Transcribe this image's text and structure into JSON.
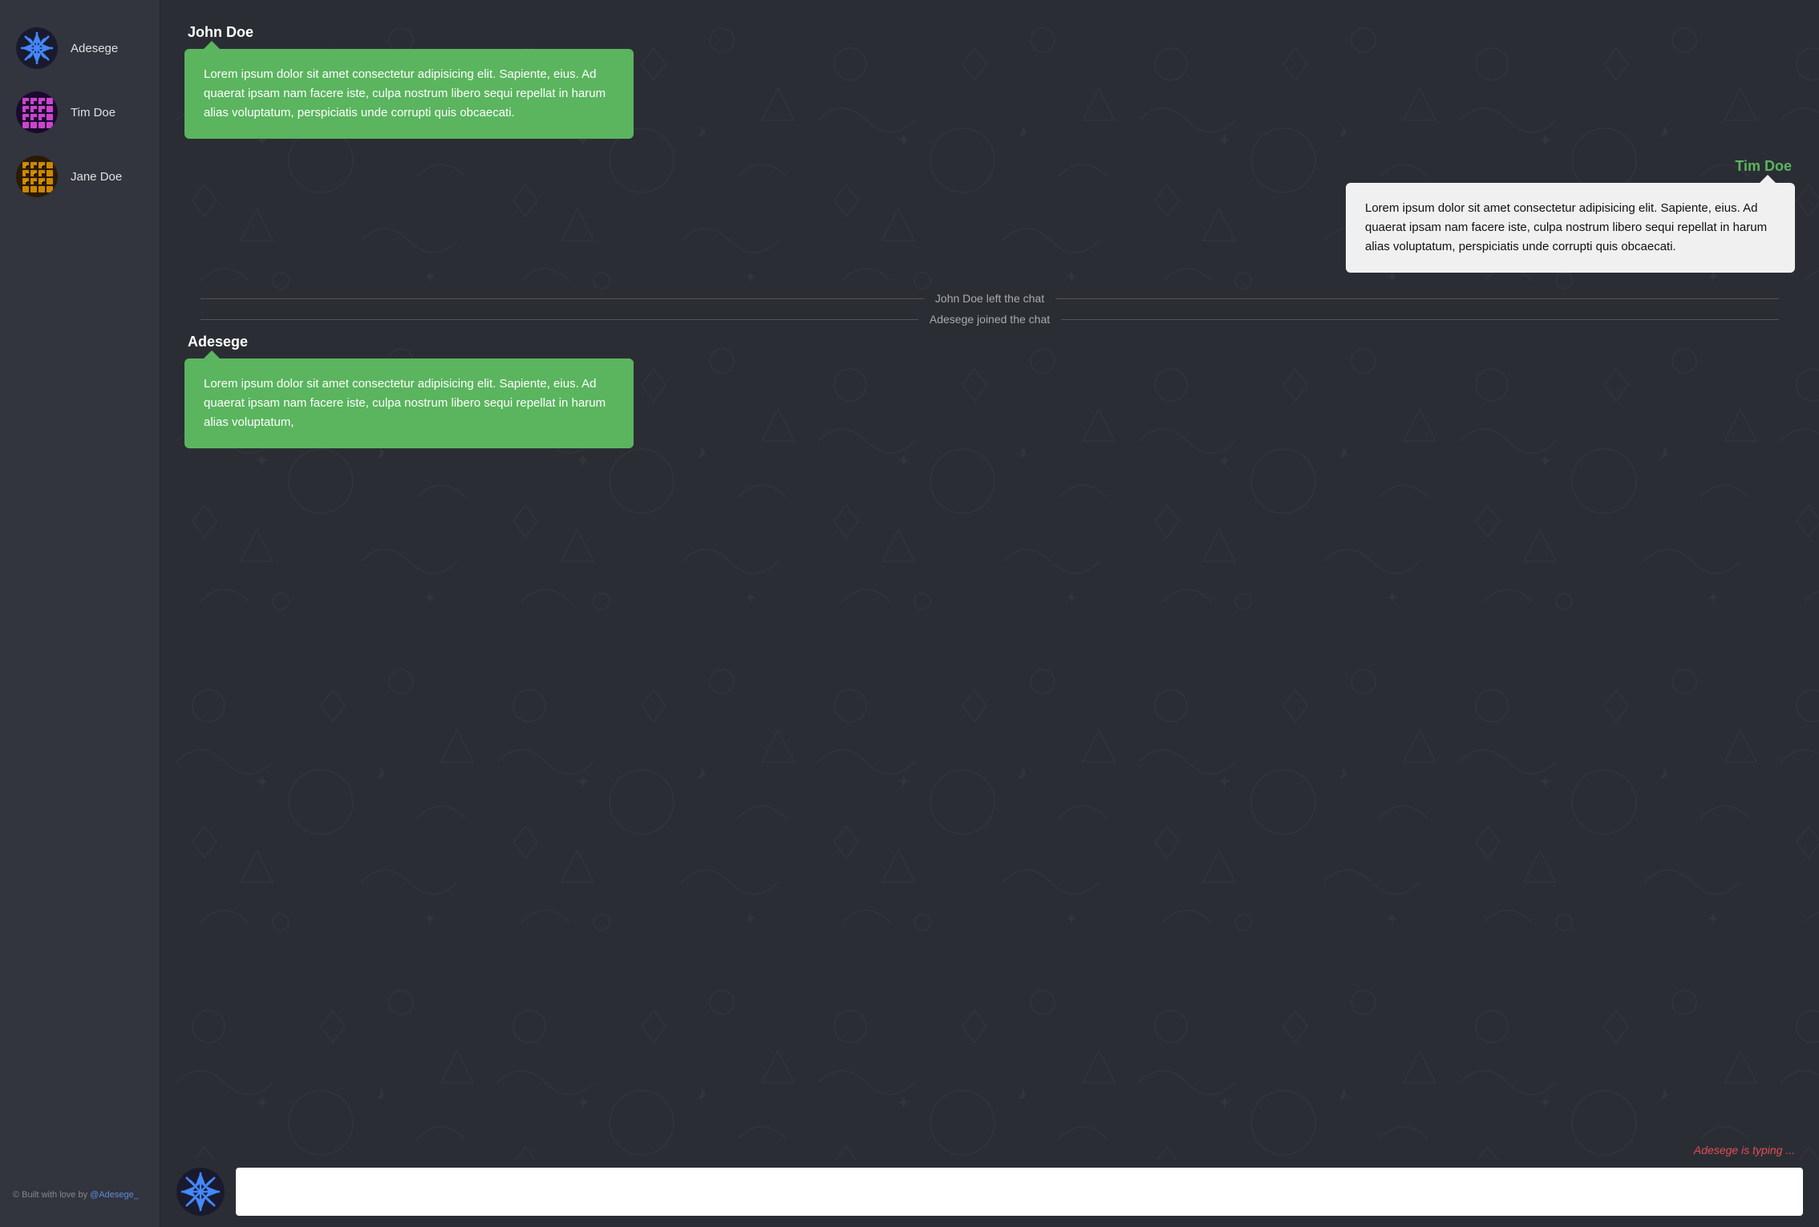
{
  "sidebar": {
    "users": [
      {
        "name": "Adesege",
        "avatar_type": "snowflake_blue"
      },
      {
        "name": "Tim Doe",
        "avatar_type": "grid_purple"
      },
      {
        "name": "Jane Doe",
        "avatar_type": "grid_orange"
      }
    ],
    "footer_text": "© Built with love by ",
    "footer_link_text": "@Adesege_",
    "footer_link_href": "#"
  },
  "chat": {
    "messages": [
      {
        "id": "msg1",
        "sender": "John Doe",
        "side": "left",
        "text": "Lorem ipsum dolor sit amet consectetur adipisicing elit. Sapiente, eius. Ad quaerat ipsam nam facere iste, culpa nostrum libero sequi repellat in harum alias voluptatum, perspiciatis unde corrupti quis obcaecati."
      },
      {
        "id": "msg2",
        "sender": "Tim Doe",
        "side": "right",
        "text": "Lorem ipsum dolor sit amet consectetur adipisicing elit. Sapiente, eius. Ad quaerat ipsam nam facere iste, culpa nostrum libero sequi repellat in harum alias voluptatum, perspiciatis unde corrupti quis obcaecati."
      }
    ],
    "system_messages": [
      {
        "id": "sys1",
        "text": "John Doe left the chat"
      },
      {
        "id": "sys2",
        "text": "Adesege joined the chat"
      }
    ],
    "adesege_message": {
      "sender": "Adesege",
      "text": "Lorem ipsum dolor sit amet consectetur adipisicing elit. Sapiente, eius. Ad quaerat ipsam nam facere iste, culpa nostrum libero sequi repellat in harum alias voluptatum,"
    },
    "typing_indicator": "Adesege is typing ...",
    "input_placeholder": ""
  },
  "colors": {
    "green_bubble": "#5ab55e",
    "right_bubble": "#f0f0f0",
    "sender_green": "#5ab55e",
    "typing_red": "#e05050"
  }
}
